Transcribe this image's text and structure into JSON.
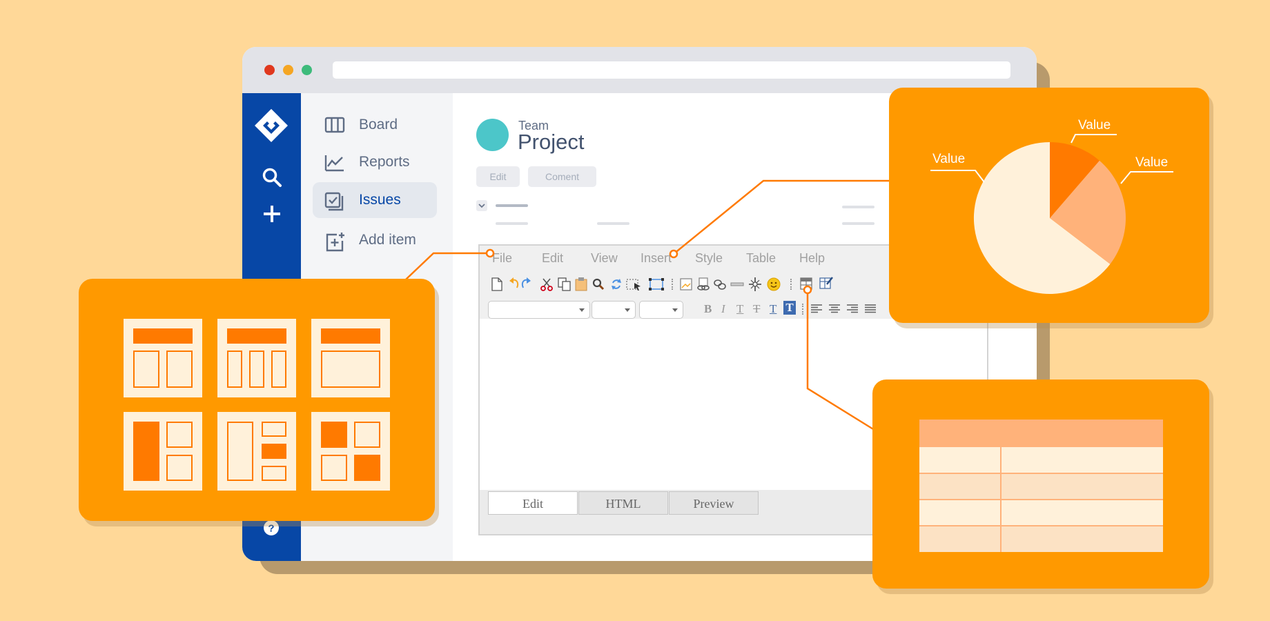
{
  "window": {
    "traffic_lights": [
      "#E0381E",
      "#F5A623",
      "#3DBB7B"
    ],
    "rail_icons": [
      "jira-logo-icon",
      "search-icon",
      "plus-icon",
      "help-icon"
    ]
  },
  "sidebar": {
    "items": [
      {
        "label": "Board",
        "icon": "board-icon"
      },
      {
        "label": "Reports",
        "icon": "reports-icon"
      },
      {
        "label": "Issues",
        "icon": "issues-icon",
        "active": true
      },
      {
        "label": "Add item",
        "icon": "add-item-icon"
      }
    ]
  },
  "project": {
    "team": "Team",
    "name": "Project",
    "buttons": {
      "edit": "Edit",
      "comment": "Coment"
    }
  },
  "editor": {
    "menu": [
      "File",
      "Edit",
      "View",
      "Insert",
      "Style",
      "Table",
      "Help"
    ],
    "format_glyphs": [
      "B",
      "I",
      "T",
      "T",
      "T",
      "T"
    ],
    "tabs": [
      "Edit",
      "HTML",
      "Preview"
    ],
    "active_tab": "Edit"
  },
  "pie_panel": {
    "labels": [
      "Value",
      "Value",
      "Value"
    ],
    "colors": [
      "#FF7A00",
      "#FFB27A",
      "#FFF1DA"
    ]
  },
  "colors": {
    "orange": "#FF9900",
    "deep_orange": "#FF7A00",
    "cream": "#FFF1DA",
    "background": "#FFD898",
    "rail": "#0747A6"
  }
}
